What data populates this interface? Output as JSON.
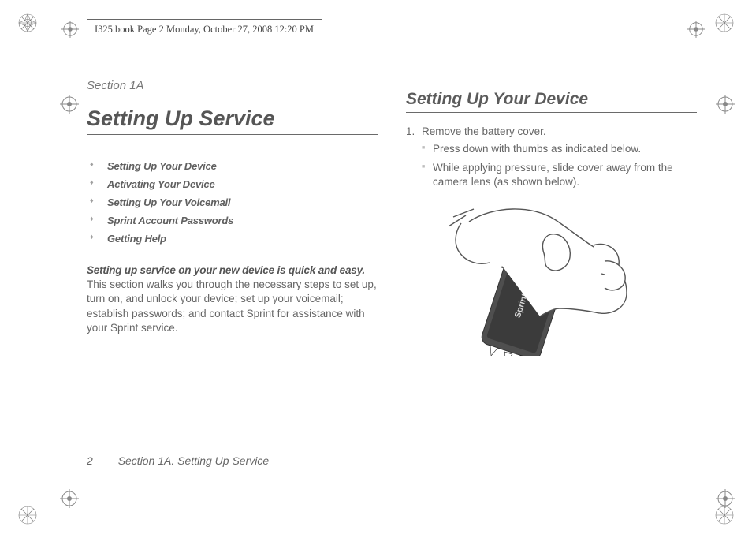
{
  "meta": {
    "header_text": "I325.book  Page 2  Monday, October 27, 2008  12:20 PM"
  },
  "left": {
    "section_label": "Section 1A",
    "title": "Setting Up Service",
    "toc": [
      "Setting Up Your Device",
      "Activating Your Device",
      "Setting Up Your Voicemail",
      "Sprint Account Passwords",
      "Getting Help"
    ],
    "intro_lead": "Setting up service on your new device is quick and easy.",
    "intro_rest": " This section walks you through the necessary steps to set up, turn on, and unlock your device; set up your voicemail; establish passwords; and contact Sprint for assistance with your Sprint service."
  },
  "right": {
    "title": "Setting Up Your Device",
    "step1_num": "1.",
    "step1_text": "Remove the battery cover.",
    "sub1": "Press down with thumbs as indicated below.",
    "sub2": "While applying pressure, slide cover away from the camera lens (as shown below).",
    "device_label": "Sprint"
  },
  "footer": {
    "page_number": "2",
    "running_title": "Section 1A. Setting Up Service"
  }
}
